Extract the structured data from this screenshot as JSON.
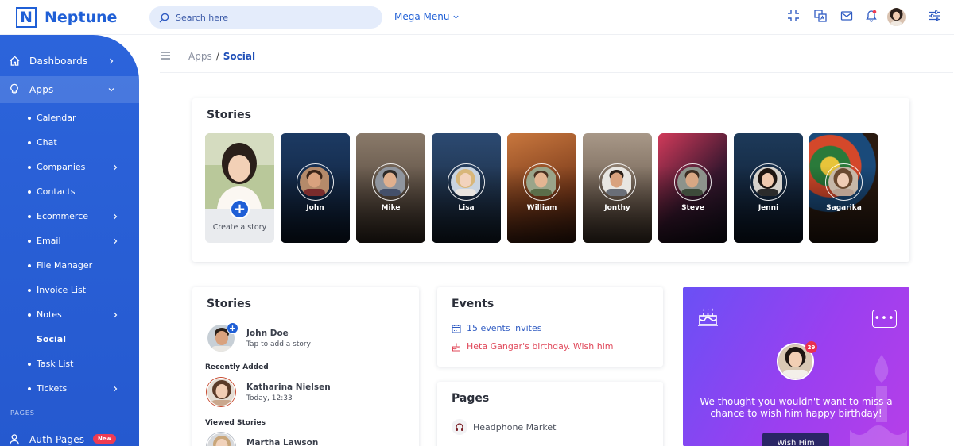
{
  "app": {
    "name": "Neptune",
    "logo_letter": "N"
  },
  "header": {
    "search_placeholder": "Search here",
    "mega_menu": "Mega Menu",
    "icons": [
      "fullscreen-icon",
      "translate-icon",
      "mail-icon",
      "bell-icon",
      "avatar",
      "settings-sliders-icon"
    ]
  },
  "sidebar": {
    "dashboards": "Dashboards",
    "apps": "Apps",
    "sub_items": [
      {
        "label": "Calendar",
        "has_children": false
      },
      {
        "label": "Chat",
        "has_children": false
      },
      {
        "label": "Companies",
        "has_children": true
      },
      {
        "label": "Contacts",
        "has_children": false
      },
      {
        "label": "Ecommerce",
        "has_children": true
      },
      {
        "label": "Email",
        "has_children": true
      },
      {
        "label": "File Manager",
        "has_children": false
      },
      {
        "label": "Invoice List",
        "has_children": false
      },
      {
        "label": "Notes",
        "has_children": true
      },
      {
        "label": "Social",
        "has_children": false,
        "current": true
      },
      {
        "label": "Task List",
        "has_children": false
      },
      {
        "label": "Tickets",
        "has_children": true
      }
    ],
    "section_pages": "PAGES",
    "auth_pages": "Auth Pages",
    "new_badge": "New"
  },
  "breadcrumb": {
    "parent": "Apps",
    "separator": "/",
    "current": "Social"
  },
  "stories_strip": {
    "title": "Stories",
    "create_label": "Create a story",
    "stories": [
      {
        "name": "John"
      },
      {
        "name": "Mike"
      },
      {
        "name": "Lisa"
      },
      {
        "name": "William"
      },
      {
        "name": "Jonthy"
      },
      {
        "name": "Steve"
      },
      {
        "name": "Jenni"
      },
      {
        "name": "Sagarika"
      }
    ]
  },
  "stories_list": {
    "title": "Stories",
    "me": {
      "name": "John Doe",
      "subtitle": "Tap to add a story"
    },
    "recently_added_label": "Recently Added",
    "recent": {
      "name": "Katharina Nielsen",
      "subtitle": "Today, 12:33"
    },
    "viewed_label": "Viewed Stories",
    "viewed": {
      "name": "Martha Lawson"
    }
  },
  "events": {
    "title": "Events",
    "invites": "15 events invites",
    "birthday": "Heta Gangar's birthday. Wish him",
    "colors": {
      "invites": "#2f5bc2",
      "birthday": "#e0485a"
    }
  },
  "pages": {
    "title": "Pages",
    "items": [
      {
        "label": "Headphone Market"
      }
    ]
  },
  "birthday_card": {
    "badge": "29",
    "message": "We thought you wouldn't want to miss a chance to wish him happy birthday!",
    "button": "Wish Him",
    "more": "•••"
  },
  "colors": {
    "primary": "#1f5fd6",
    "sidebar": "#2c64db",
    "danger": "#ef3b52"
  }
}
